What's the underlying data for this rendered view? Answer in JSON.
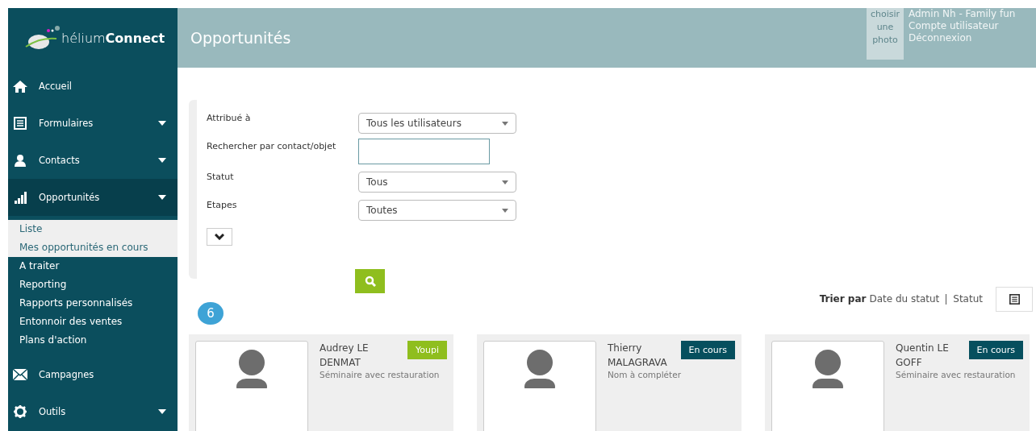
{
  "logo": {
    "light": "hélium",
    "bold": "Connect"
  },
  "header": {
    "title": "Opportunités",
    "photo": "choisir une photo",
    "user": "Admin Nh - Family fun",
    "links": [
      "Compte utilisateur",
      "Déconnexion"
    ]
  },
  "sidebar": {
    "items": [
      {
        "kind": "home",
        "label": "Accueil",
        "expanded": false,
        "has_caret": false
      },
      {
        "kind": "form",
        "label": "Formulaires",
        "expanded": false,
        "has_caret": true
      },
      {
        "kind": "user",
        "label": "Contacts",
        "expanded": false,
        "has_caret": true
      },
      {
        "kind": "bars",
        "label": "Opportunités",
        "expanded": true,
        "has_caret": true,
        "children": [
          {
            "label": "Liste",
            "selected": true
          },
          {
            "label": "Mes opportunités en cours",
            "selected": true
          },
          {
            "label": "A traiter",
            "selected": false
          },
          {
            "label": "Reporting",
            "selected": false
          },
          {
            "label": "Rapports personnalisés",
            "selected": false
          },
          {
            "label": "Entonnoir des ventes",
            "selected": false
          },
          {
            "label": "Plans d'action",
            "selected": false
          }
        ]
      },
      {
        "kind": "mail",
        "label": "Campagnes",
        "expanded": false,
        "has_caret": false
      },
      {
        "kind": "gear",
        "label": "Outils",
        "expanded": false,
        "has_caret": true
      }
    ]
  },
  "filters": [
    {
      "kind": "select",
      "label": "Attribué à",
      "value": "Tous les utilisateurs"
    },
    {
      "kind": "text",
      "label": "Rechercher par contact/objet"
    },
    {
      "kind": "select",
      "label": "Statut",
      "value": "Tous"
    },
    {
      "kind": "select",
      "label": "Etapes",
      "value": "Toutes"
    }
  ],
  "sort": {
    "label": "Trier par",
    "options": [
      "Date du statut",
      "Statut"
    ]
  },
  "count": "6",
  "cards": [
    {
      "name": "Audrey LE DENMAT",
      "subject": "Séminaire avec restauration",
      "status": "Youpi",
      "color": "#8fbe1e"
    },
    {
      "name": "Thierry MALAGRAVA",
      "subject": "Nom à compléter",
      "status": "En cours",
      "color": "#064f5e"
    },
    {
      "name": "Quentin LE GOFF",
      "subject": "Séminaire avec restauration",
      "status": "En cours",
      "color": "#064f5e"
    }
  ]
}
